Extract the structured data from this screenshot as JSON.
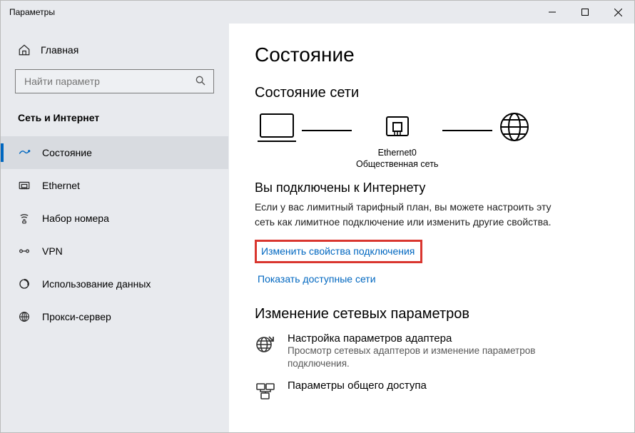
{
  "window": {
    "title": "Параметры"
  },
  "sidebar": {
    "home": "Главная",
    "search_placeholder": "Найти параметр",
    "section": "Сеть и Интернет",
    "items": [
      {
        "label": "Состояние"
      },
      {
        "label": "Ethernet"
      },
      {
        "label": "Набор номера"
      },
      {
        "label": "VPN"
      },
      {
        "label": "Использование данных"
      },
      {
        "label": "Прокси-сервер"
      }
    ]
  },
  "main": {
    "title": "Состояние",
    "net_status_heading": "Состояние сети",
    "diagram": {
      "adapter_name": "Ethernet0",
      "adapter_type": "Общественная сеть"
    },
    "connected_title": "Вы подключены к Интернету",
    "connected_desc": "Если у вас лимитный тарифный план, вы можете настроить эту сеть как лимитное подключение или изменить другие свойства.",
    "link_change_props": "Изменить свойства подключения",
    "link_show_networks": "Показать доступные сети",
    "change_params_heading": "Изменение сетевых параметров",
    "opt1_title": "Настройка параметров адаптера",
    "opt1_desc": "Просмотр сетевых адаптеров и изменение параметров подключения.",
    "opt2_title": "Параметры общего доступа"
  }
}
